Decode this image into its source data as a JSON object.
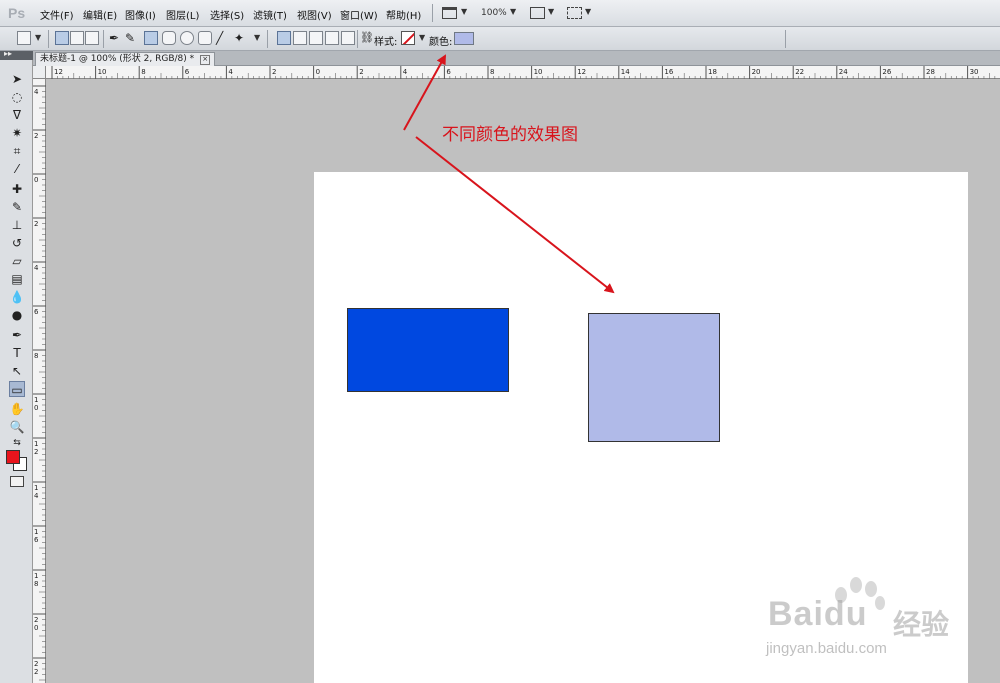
{
  "app": {
    "logo": "Ps"
  },
  "menu": {
    "items": [
      "文件(F)",
      "编辑(E)",
      "图像(I)",
      "图层(L)",
      "选择(S)",
      "滤镜(T)",
      "视图(V)",
      "窗口(W)",
      "帮助(H)"
    ],
    "zoom": "100%"
  },
  "options_bar": {
    "style_label": "样式:",
    "color_label": "颜色:",
    "current_color": "#b0bae8"
  },
  "document": {
    "tab_title": "未标题-1 @ 100% (形状 2, RGB/8) *"
  },
  "rulers": {
    "horizontal_ticks": [
      "12",
      "10",
      "8",
      "6",
      "4",
      "2",
      "0",
      "2",
      "4",
      "6",
      "8",
      "10",
      "12",
      "14",
      "16",
      "18",
      "20",
      "22",
      "24",
      "26",
      "28",
      "30"
    ],
    "vertical_ticks": [
      "4",
      "2",
      "0",
      "2",
      "4",
      "6",
      "8",
      "10",
      "12",
      "14",
      "16",
      "18",
      "20",
      "22"
    ]
  },
  "canvas": {
    "background": "#ffffff",
    "shapes": [
      {
        "name": "blue-rectangle",
        "fill": "#0048e0"
      },
      {
        "name": "light-blue-square",
        "fill": "#b0bae8"
      }
    ]
  },
  "annotation": {
    "text": "不同颜色的效果图",
    "color": "#d8141c"
  },
  "tools": {
    "foreground_color": "#e8141c",
    "background_color": "#ffffff"
  },
  "watermark": {
    "brand": "Bai",
    "brand_du": "du",
    "cn": "经验",
    "url": "jingyan.baidu.com"
  }
}
